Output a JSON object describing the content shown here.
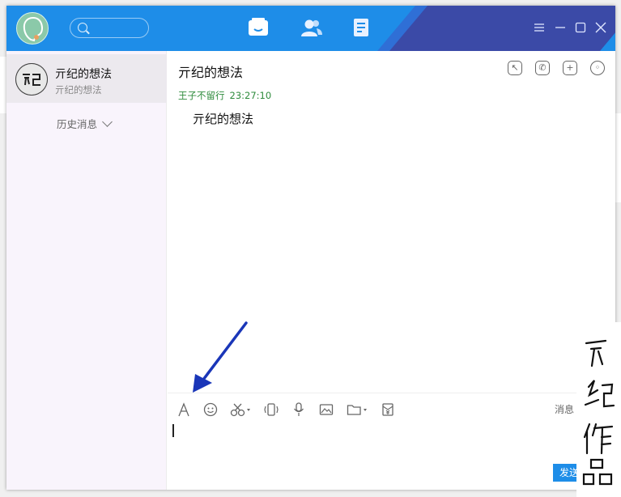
{
  "window": {
    "accent": "#1e8de8",
    "nav": [
      "chat-icon",
      "contacts-icon",
      "notes-icon"
    ],
    "controls": [
      "menu-icon",
      "minimize-icon",
      "maximize-icon",
      "close-icon"
    ]
  },
  "sidebar": {
    "contact_name": "亓纪的想法",
    "contact_preview": "亓纪的想法",
    "history_label": "历史消息"
  },
  "chat": {
    "title": "亓纪的想法",
    "sender": "王子不留行",
    "time": "23:27:10",
    "message": "亓纪的想法"
  },
  "composer": {
    "hint": "消息",
    "send_label": "发送",
    "tools": [
      "font-icon",
      "emoji-icon",
      "screenshot-icon",
      "shake-icon",
      "voice-icon",
      "image-icon",
      "folder-icon",
      "red-packet-icon"
    ]
  }
}
